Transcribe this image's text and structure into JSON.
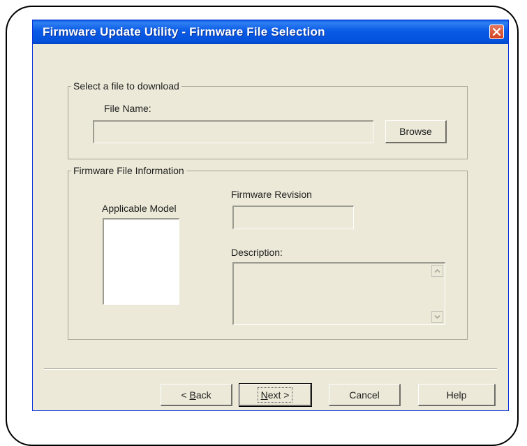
{
  "window": {
    "title": "Firmware Update Utility - Firmware File Selection"
  },
  "file_group": {
    "legend": "Select a file to download",
    "file_name_label": "File Name:",
    "file_name_value": "",
    "browse_label": "Browse"
  },
  "info_group": {
    "legend": "Firmware File Information",
    "applicable_model_label": "Applicable Model",
    "applicable_models": [],
    "firmware_revision_label": "Firmware Revision",
    "firmware_revision_value": "",
    "description_label": "Description:",
    "description_value": ""
  },
  "buttons": {
    "back_prefix": "< ",
    "back_mnemonic": "B",
    "back_rest": "ack",
    "next_mnemonic": "N",
    "next_rest": "ext >",
    "cancel": "Cancel",
    "help": "Help"
  },
  "icons": {
    "close": "close-icon",
    "scroll_up": "chevron-up-icon",
    "scroll_down": "chevron-down-icon"
  }
}
